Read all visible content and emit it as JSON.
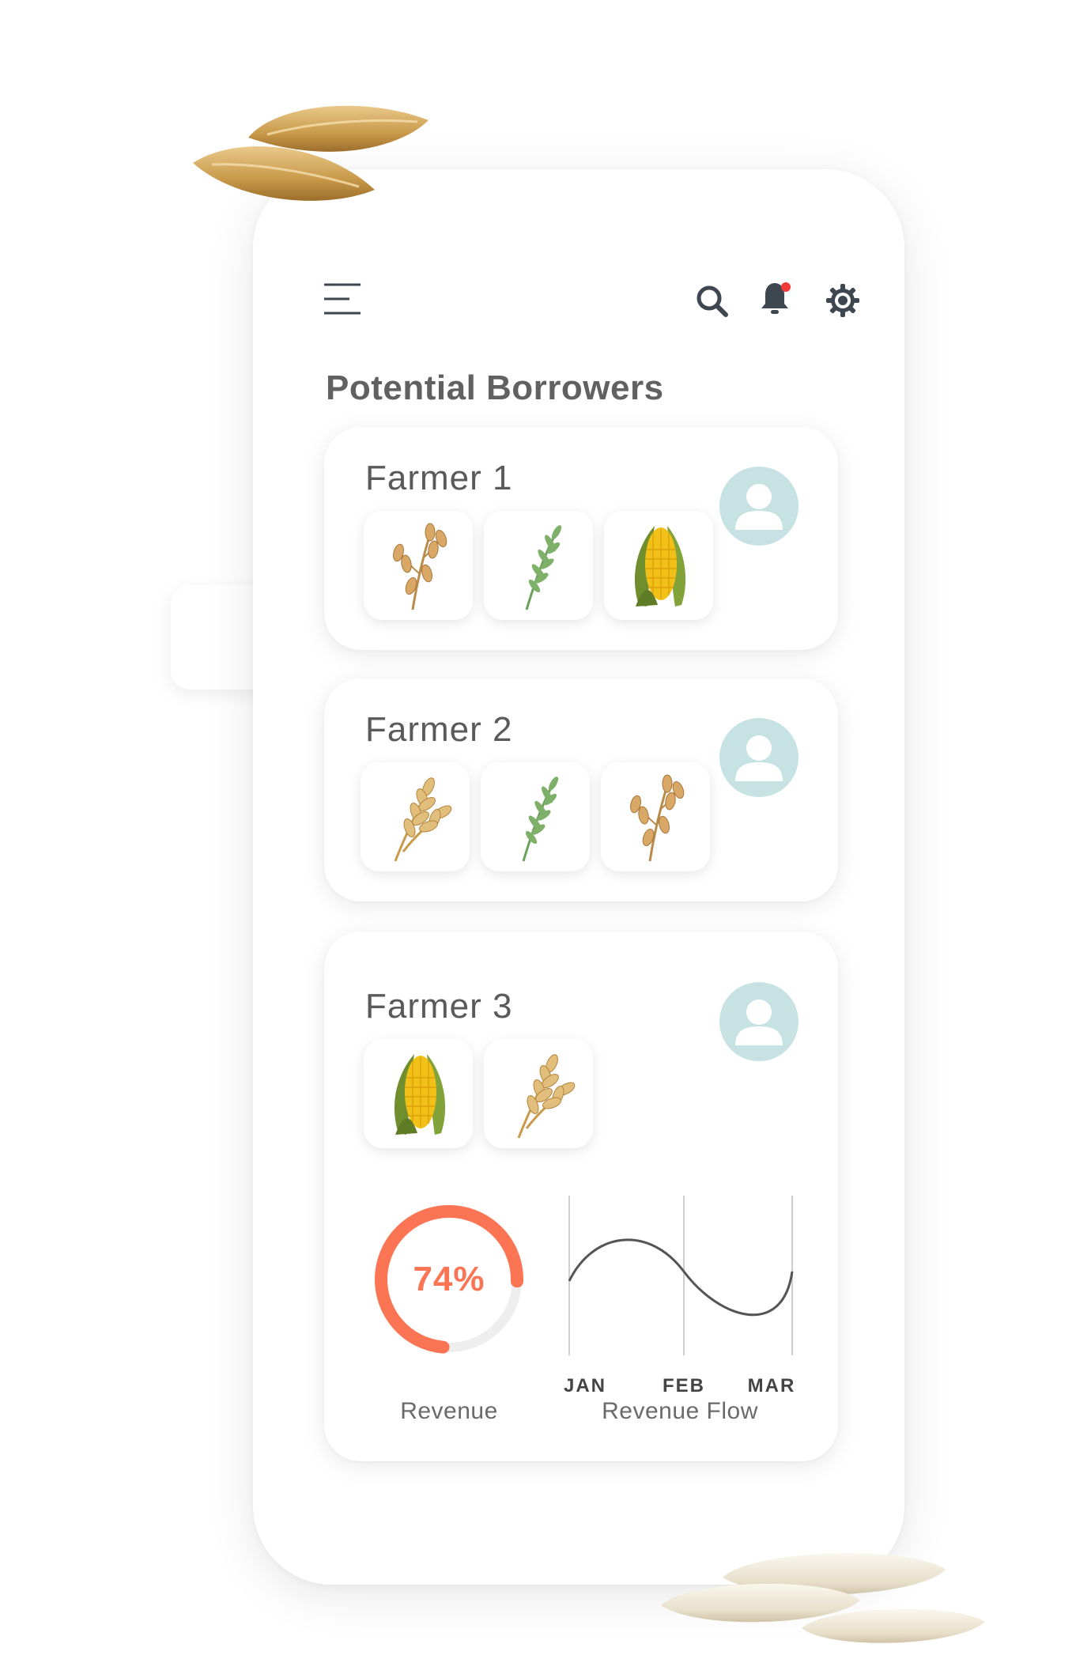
{
  "header": {
    "icons": [
      "menu-icon",
      "search-icon",
      "notification-bell-icon",
      "settings-gear-icon"
    ],
    "notification_dot_color": "#f03a3a"
  },
  "page": {
    "title": "Potential Borrowers"
  },
  "farmers": [
    {
      "name": "Farmer 1",
      "crops": [
        "oat",
        "millet",
        "corn"
      ]
    },
    {
      "name": "Farmer 2",
      "crops": [
        "wheat",
        "millet",
        "oat"
      ]
    },
    {
      "name": "Farmer 3",
      "crops": [
        "corn",
        "wheat"
      ]
    }
  ],
  "revenue": {
    "value": "74%",
    "percent": 74,
    "label": "Revenue",
    "color": "#fb7453"
  },
  "revenue_flow": {
    "label": "Revenue Flow",
    "months": [
      "JAN",
      "FEB",
      "MAR"
    ]
  },
  "colors": {
    "avatar_bg": "#c6e2e2",
    "title_text": "#616161",
    "icon_color": "#3e4650"
  }
}
